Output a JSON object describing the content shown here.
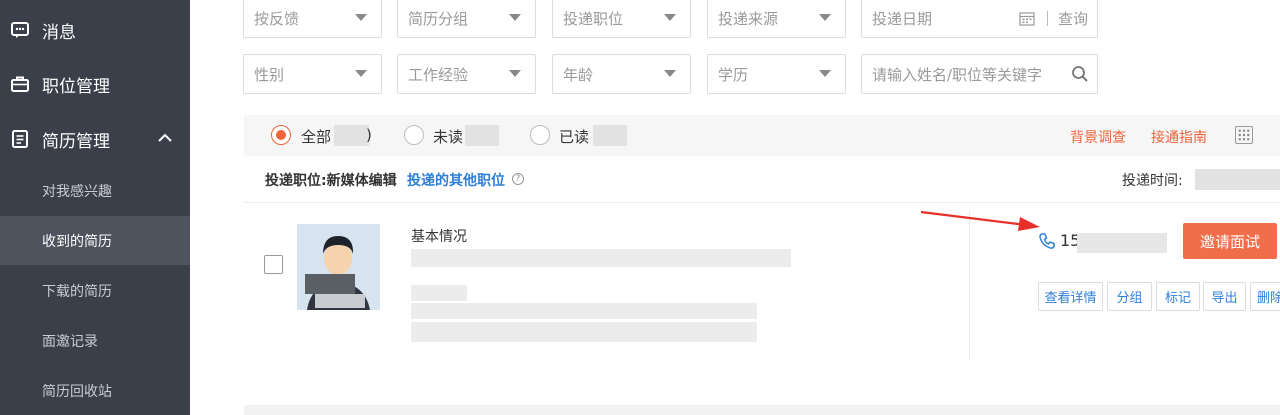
{
  "sidebar": {
    "items": [
      {
        "label": "消息",
        "icon": "message-icon"
      },
      {
        "label": "职位管理",
        "icon": "briefcase-icon"
      },
      {
        "label": "简历管理",
        "icon": "document-icon",
        "expanded": true
      }
    ],
    "sub_items": [
      {
        "label": "对我感兴趣"
      },
      {
        "label": "收到的简历",
        "active": true
      },
      {
        "label": "下载的简历"
      },
      {
        "label": "面邀记录"
      },
      {
        "label": "简历回收站"
      }
    ]
  },
  "filters": {
    "feedback": "按反馈",
    "resume_group": "简历分组",
    "job": "投递职位",
    "source": "投递来源",
    "date": "投递日期",
    "query": "查询",
    "gender": "性别",
    "experience": "工作经验",
    "age": "年龄",
    "education": "学历",
    "search_placeholder": "请输入姓名/职位等关键字"
  },
  "tabs": {
    "all": "全部",
    "all_suffix": ")",
    "unread": "未读",
    "read": "已读",
    "background_check": "背景调查",
    "connect_guide": "接通指南"
  },
  "job_info": {
    "label": "投递职位:新媒体编辑",
    "other_jobs": "投递的其他职位",
    "time_label": "投递时间:"
  },
  "candidate": {
    "basic_title": "基本情况",
    "phone": "15",
    "invite_label": "邀请面试",
    "actions": [
      "查看详情",
      "分组",
      "标记",
      "导出",
      "删除"
    ]
  },
  "colors": {
    "sidebar_bg": "#3b3f4a",
    "accent": "#f0643c",
    "link": "#2f7fd9"
  }
}
